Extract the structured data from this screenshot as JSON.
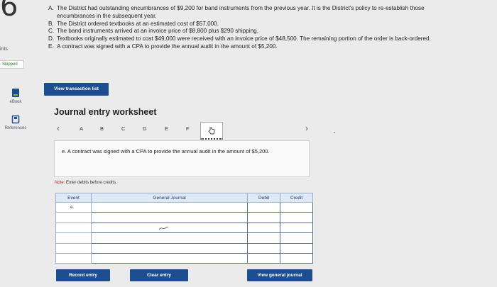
{
  "question_number": "6",
  "sidebar": {
    "points_label": "ints",
    "status_badge": "Skipped",
    "ebook_label": "eBook",
    "references_label": "References"
  },
  "problem_items": [
    {
      "letter": "A.",
      "text": "The District had outstanding encumbrances of $9,200 for band instruments from the previous year. It is the District's policy to re-establish those encumbrances in the subsequent year."
    },
    {
      "letter": "B.",
      "text": "The District ordered textbooks at an estimated cost of $57,000."
    },
    {
      "letter": "C.",
      "text": "The band instruments arrived at an invoice price of $8,800 plus $290 shipping."
    },
    {
      "letter": "D.",
      "text": "Textbooks originally estimated to cost $49,000 were received with an invoice price of $48,500. The remaining portion of the order is back-ordered."
    },
    {
      "letter": "E.",
      "text": "A contract was signed with a CPA to provide the annual audit in the amount of $5,200."
    }
  ],
  "view_transaction_button": "View transaction list",
  "worksheet": {
    "title": "Journal entry worksheet",
    "tabs": [
      "A",
      "B",
      "C",
      "D",
      "E",
      "F"
    ],
    "description": "e. A contract was signed with a CPA to provide the annual audit in the amount of $5,200.",
    "note_label": "Note:",
    "note_text": "Enter debits before credits.",
    "columns": {
      "event": "Event",
      "journal": "General Journal",
      "debit": "Debit",
      "credit": "Credit"
    },
    "rows": [
      {
        "event": "e."
      },
      {
        "event": ""
      },
      {
        "event": ""
      },
      {
        "event": ""
      },
      {
        "event": ""
      },
      {
        "event": ""
      }
    ]
  },
  "buttons": {
    "record": "Record entry",
    "clear": "Clear entry",
    "view_journal": "View general journal"
  },
  "colors": {
    "primary_button": "#1d4e8f",
    "header_fill": "#dfe9f5",
    "skipped_text": "#2a7a2a"
  }
}
